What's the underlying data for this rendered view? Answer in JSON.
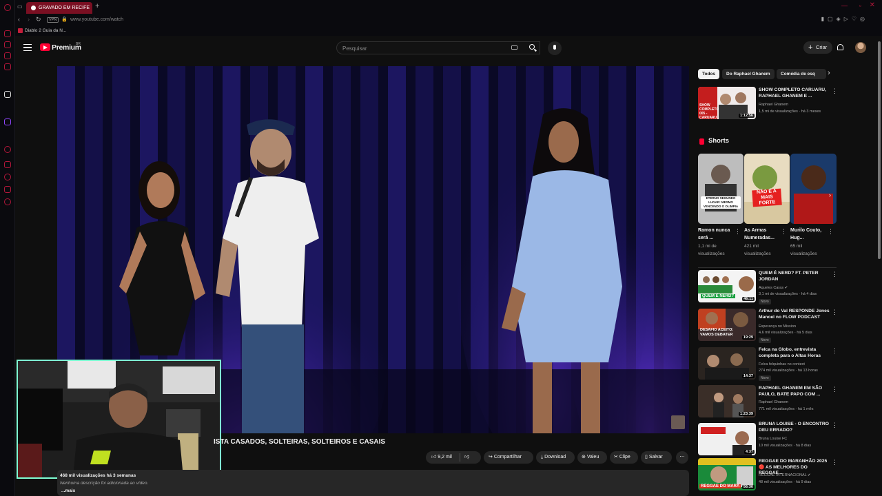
{
  "browser": {
    "tab_title": "GRAVADO EM RECIFE",
    "url": "www.youtube.com/watch",
    "vpn_label": "VPN",
    "bookmark": "Diablo 2 Guia da N..."
  },
  "header": {
    "brand": "Premium",
    "region": "BR",
    "search_placeholder": "Pesquisar",
    "create_label": "Criar"
  },
  "video": {
    "title": "ISTA CASADOS, SOLTEIRAS, SOLTEIROS E CASAIS",
    "likes": "9,2 mil",
    "share": "Compartilhar",
    "download": "Download",
    "thanks": "Valeu",
    "clip": "Clipe",
    "save": "Salvar",
    "views_date": "468 mil visualizações  há 3 semanas",
    "description": "Nenhuma descrição foi adicionada ao vídeo.",
    "more": "...mais"
  },
  "sidebar": {
    "chips": [
      "Todos",
      "Do Raphael Ghanem",
      "Comédia de esq"
    ],
    "first": {
      "title": "SHOW COMPLETO CARUARU, RAPHAEL GHANEM E ...",
      "channel": "Raphael Ghanem",
      "meta": "1,5 mi de visualizações · há 3 meses",
      "duration": "1:12:56",
      "thumb_text": "SHOW COMPLETO 005 - CARUARU"
    },
    "shorts_heading": "Shorts",
    "shorts": [
      {
        "title": "Ramon nunca será ...",
        "views": "1,1 mi de visualizações",
        "thumb_text": "ETERNO SEGUNDO LUGAR: MESMO VENCENDO O OLIMPIA"
      },
      {
        "title": "As Armas Numeradas...",
        "views": "421 mil visualizações",
        "thumb_text": "NÃO É A MAIS FORTE"
      },
      {
        "title": "Murilo Couto, Hug...",
        "views": "65 mil visualizações",
        "thumb_text": ""
      }
    ],
    "videos": [
      {
        "title": "QUEM É NERD? FT. PETER JORDAN",
        "channel": "Aqueles Caras ✔",
        "meta": "3,1 mi de visualizações · há 4 dias",
        "duration": "46:11",
        "badge": "Novo",
        "thumb_text": "QUEM É NERD?"
      },
      {
        "title": "Arthur do Val RESPONDE Jones Manoel no FLOW PODCAST",
        "channel": "Esperança no Mission",
        "meta": "4,6 mil visualizações · há 5 dias",
        "duration": "19:29",
        "badge": "Novo",
        "thumb_text": "DESAFIO ACEITO: VAMOS DEBATER"
      },
      {
        "title": "Felca na Globo, entrevista completa para o Altas Horas",
        "channel": "Felca felquinhas no context",
        "meta": "274 mil visualizações · há 13 horas",
        "duration": "14:37",
        "badge": "Novo",
        "thumb_text": ""
      },
      {
        "title": "RAPHAEL GHANEM EM SÃO PAULO, BATE PAPO COM ...",
        "channel": "Raphael Ghanem",
        "meta": "771 mil visualizações · há 1 mês",
        "duration": "1:23:39",
        "badge": "",
        "thumb_text": ""
      },
      {
        "title": "BRUNA LOUISE - O ENCONTRO DEU ERRADO?",
        "channel": "Bruna Louise FC",
        "meta": "10 mil visualizações · há 8 dias",
        "duration": "4:37",
        "badge": "",
        "thumb_text": ""
      },
      {
        "title": "REGGAE DO MARANHÃO 2025 🔴 AS MELHORES DO REGGAE...",
        "channel": "REGGAE INTERNACIONAL ✔",
        "meta": "48 mil visualizações · há 9 dias",
        "duration": "56:30",
        "badge": "",
        "thumb_text": "REGGAE DO MARA"
      }
    ]
  },
  "colors": {
    "accent": "#ff0033",
    "browser_accent": "#b3173a",
    "webcam_border": "#7fffd4",
    "background": "#0f0f0f"
  }
}
